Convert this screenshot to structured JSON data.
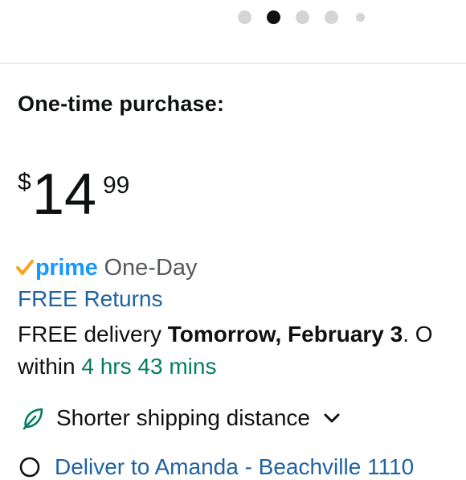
{
  "carousel": {
    "dots": 5,
    "active_index": 1
  },
  "purchase": {
    "title": "One-time purchase:",
    "price": {
      "currency": "$",
      "whole": "14",
      "fraction": "99"
    }
  },
  "prime": {
    "label": "prime",
    "tier": "One-Day"
  },
  "returns": {
    "label": "FREE Returns"
  },
  "delivery": {
    "prefix": "FREE delivery ",
    "date": "Tomorrow, February 3",
    "cut_text": ". O",
    "within_label": "within ",
    "time_left": "4 hrs 43 mins"
  },
  "shipping": {
    "label": "Shorter shipping distance"
  },
  "deliver_to": {
    "label": "Deliver to Amanda - Beachville 1110"
  },
  "colors": {
    "prime_blue": "#1a98ff",
    "prime_check": "#f7a41d",
    "link_blue": "#2162a1",
    "green": "#067d62",
    "text": "#0f1111"
  },
  "icons": [
    "prime-check-icon",
    "leaf-icon",
    "chevron-down-icon",
    "location-pin-icon"
  ]
}
